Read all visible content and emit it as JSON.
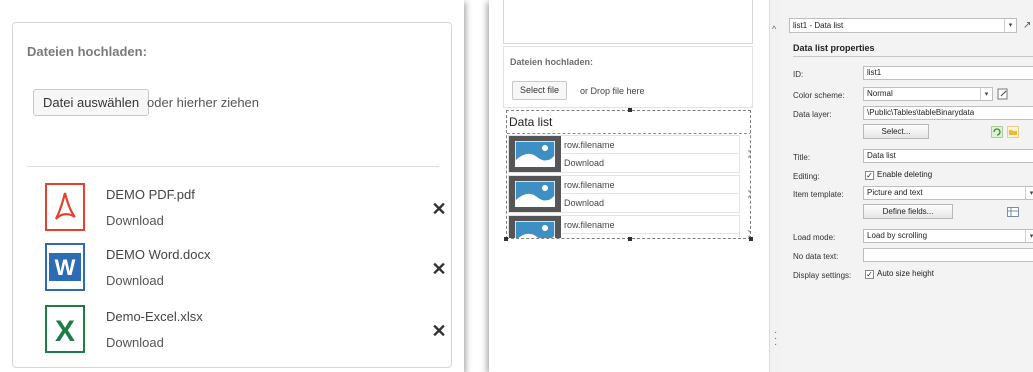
{
  "left_preview": {
    "heading": "Dateien hochladen:",
    "select_file_button": "Datei auswählen",
    "drop_text": "oder hierher ziehen",
    "files": [
      {
        "name": "DEMO PDF.pdf",
        "download": "Download",
        "icon": "pdf-icon",
        "color": "#e2432a"
      },
      {
        "name": "DEMO Word.docx",
        "download": "Download",
        "icon": "word-icon",
        "color": "#2b6cb5"
      },
      {
        "name": "Demo-Excel.xlsx",
        "download": "Download",
        "icon": "excel-icon",
        "color": "#1e7d45"
      }
    ],
    "remove_glyph": "✕"
  },
  "designer_canvas": {
    "heading": "Dateien hochladen:",
    "select_file_button": "Select file",
    "drop_text": "or Drop file here",
    "data_list": {
      "title": "Data list",
      "items": [
        {
          "name": "row.filename",
          "download": "Download"
        },
        {
          "name": "row.filename",
          "download": "Download"
        },
        {
          "name": "row.filename",
          "download": ""
        }
      ]
    }
  },
  "properties": {
    "selector": "list1 - Data list",
    "title": "Data list properties",
    "fields": {
      "id_label": "ID:",
      "id_value": "list1",
      "color_scheme_label": "Color scheme:",
      "color_scheme_value": "Normal",
      "data_layer_label": "Data layer:",
      "data_layer_value": "\\Public\\Tables\\tableBinarydata",
      "select_button": "Select...",
      "title_label": "Title:",
      "title_value": "Data list",
      "editing_label": "Editing:",
      "editing_check": "Enable deleting",
      "item_template_label": "Item template:",
      "item_template_value": "Picture and text",
      "define_fields_button": "Define fields...",
      "load_mode_label": "Load mode:",
      "load_mode_value": "Load by scrolling",
      "no_data_label": "No data text:",
      "no_data_value": "",
      "display_label": "Display settings:",
      "display_check": "Auto size height"
    }
  }
}
